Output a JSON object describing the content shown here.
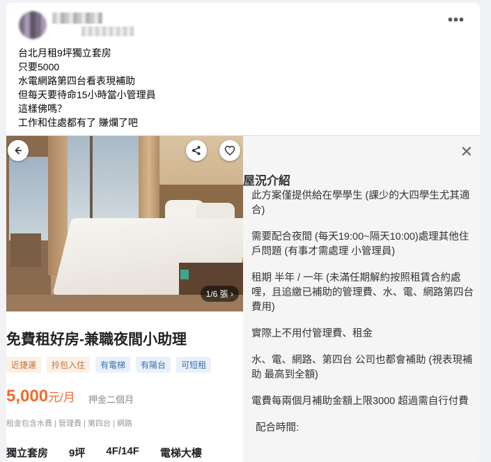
{
  "post": {
    "more_label": "•••",
    "lines": [
      "台北月租9坪獨立套房",
      "只要5000",
      "水電網路第四台看表現補助",
      "但每天要待命15小時當小管理員",
      "這樣佛嗎？",
      "工作和住處都有了 賺爛了吧"
    ]
  },
  "listing": {
    "photo_counter": "1/6 張 ›",
    "title": "免費租好房-兼職夜間小助理",
    "tags": [
      {
        "label": "近捷運",
        "color": "orange"
      },
      {
        "label": "拎包入住",
        "color": "orange"
      },
      {
        "label": "有電梯",
        "color": "blue"
      },
      {
        "label": "有陽台",
        "color": "blue"
      },
      {
        "label": "可短租",
        "color": "blue"
      }
    ],
    "price_value": "5,000",
    "price_unit": "元/月",
    "deposit": "押金二個月",
    "includes": "租金包含水費 | 管理費 | 第四台 | 網路",
    "specs": [
      "獨立套房",
      "9坪",
      "4F/14F",
      "電梯大樓"
    ]
  },
  "detail": {
    "section_title": "屋況介紹",
    "paragraphs": [
      "此方案僅提供給在學學生 (課少的大四學生尤其適合)",
      "需要配合夜間 (每天19:00~隔天10:00)處理其他住戶問題 (有事才需處理 小管理員)",
      "租期 半年 / 一年 (未滿任期解約按照租賃合約處哩，且追繳已補助的管理費、水、電、網路第四台費用)",
      "實際上不用付管理費、租金",
      "水、電、網路、第四台 公司也都會補助 (視表現補助 最高到全額)",
      "電費每兩個月補助金額上限3000 超過需自行付費"
    ],
    "footer_label": "配合時間:"
  },
  "colors": {
    "price": "#f26a2d",
    "tag_orange": "#c8703a",
    "tag_blue": "#3a6ea8"
  }
}
